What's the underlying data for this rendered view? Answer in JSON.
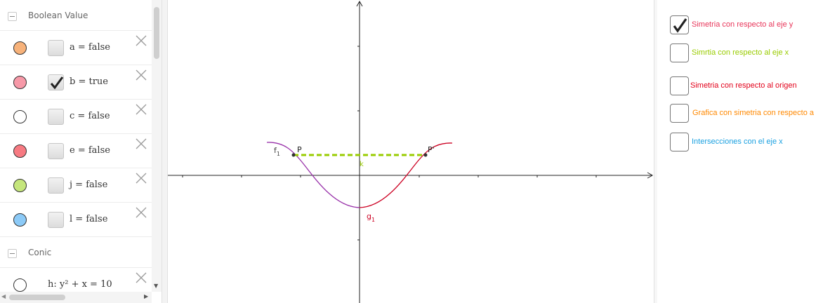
{
  "algebra": {
    "groups": [
      {
        "title": "Boolean Value"
      },
      {
        "title": "Conic"
      }
    ],
    "items": [
      {
        "expr": "a = false",
        "checked": false,
        "color": "#f7b27a"
      },
      {
        "expr": "b = true",
        "checked": true,
        "color": "#f799a8"
      },
      {
        "expr": "c = false",
        "checked": false,
        "color": "#ffffff"
      },
      {
        "expr": "e = false",
        "checked": false,
        "color": "#f77a82"
      },
      {
        "expr": "j = false",
        "checked": false,
        "color": "#c5e67c"
      },
      {
        "expr": "l = false",
        "checked": false,
        "color": "#8ccaf7"
      },
      {
        "expr": "h: y² + x = 10",
        "checked": null,
        "color": "#ffffff"
      }
    ]
  },
  "graphics": {
    "labels": {
      "f1_main": "f",
      "f1_sub": "1",
      "g1_main": "g",
      "g1_sub": "1",
      "P": "P",
      "P_prime": "P'",
      "k": "k"
    },
    "colors": {
      "f1": "#9933aa",
      "g1": "#cc0022",
      "segment_k": "#99cc00",
      "axis": "#222222"
    }
  },
  "panel2": {
    "options": [
      {
        "label": "Simetria con respecto al eje y",
        "checked": true,
        "color": "#e8365a"
      },
      {
        "label": "Simrtia con respecto al eje x",
        "checked": false,
        "color": "#99cc00"
      },
      {
        "label": "Simetria con respecto al origen",
        "checked": false,
        "color": "#e2001a"
      },
      {
        "label": "Grafica con simetria con respecto a",
        "checked": false,
        "color": "#ff8800"
      },
      {
        "label": "Intersecciones con el eje x",
        "checked": false,
        "color": "#1aa0e0"
      }
    ]
  }
}
